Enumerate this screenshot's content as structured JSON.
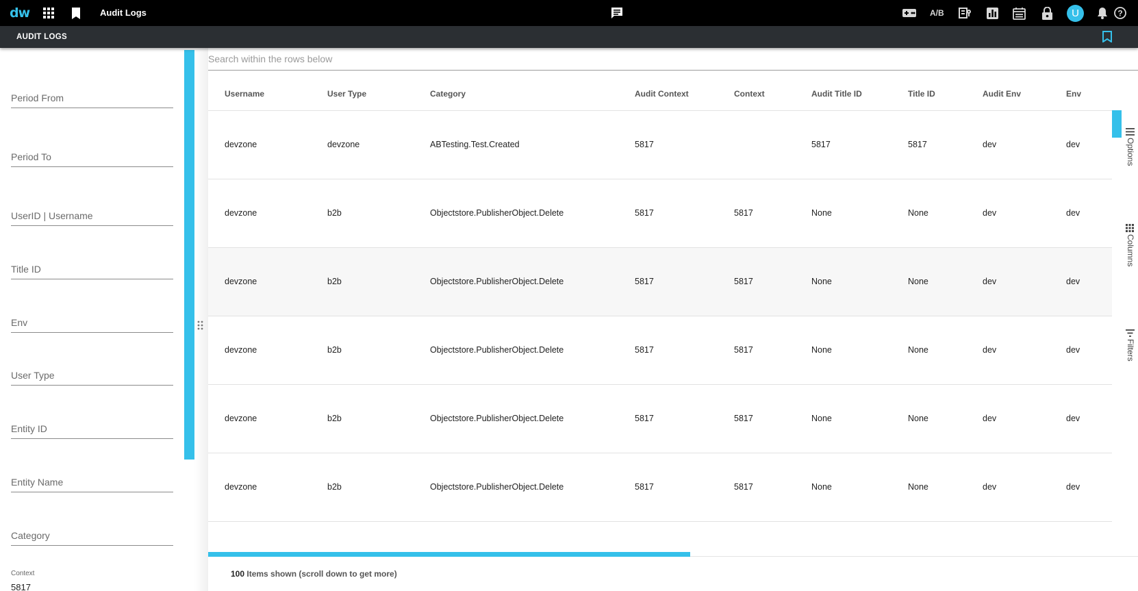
{
  "app": {
    "logo": "dw",
    "title": "Audit Logs",
    "ab_label": "A/B",
    "avatar_initial": "U"
  },
  "subheader": {
    "title": "AUDIT LOGS"
  },
  "filters": {
    "fields": [
      "Period From",
      "Period To",
      "UserID | Username",
      "Title ID",
      "Env",
      "User Type",
      "Entity ID",
      "Entity Name",
      "Category"
    ],
    "context_label": "Context",
    "context_value": "5817"
  },
  "search": {
    "placeholder": "Search within the rows below"
  },
  "table": {
    "columns": [
      "Username",
      "User Type",
      "Category",
      "Audit Context",
      "Context",
      "Audit Title ID",
      "Title ID",
      "Audit Env",
      "Env"
    ],
    "rows": [
      [
        "devzone",
        "devzone",
        "ABTesting.Test.Created",
        "5817",
        "",
        "5817",
        "5817",
        "dev",
        "dev"
      ],
      [
        "devzone",
        "b2b",
        "Objectstore.PublisherObject.Delete",
        "5817",
        "5817",
        "None",
        "None",
        "dev",
        "dev"
      ],
      [
        "devzone",
        "b2b",
        "Objectstore.PublisherObject.Delete",
        "5817",
        "5817",
        "None",
        "None",
        "dev",
        "dev"
      ],
      [
        "devzone",
        "b2b",
        "Objectstore.PublisherObject.Delete",
        "5817",
        "5817",
        "None",
        "None",
        "dev",
        "dev"
      ],
      [
        "devzone",
        "b2b",
        "Objectstore.PublisherObject.Delete",
        "5817",
        "5817",
        "None",
        "None",
        "dev",
        "dev"
      ],
      [
        "devzone",
        "b2b",
        "Objectstore.PublisherObject.Delete",
        "5817",
        "5817",
        "None",
        "None",
        "dev",
        "dev"
      ]
    ]
  },
  "side_tools": {
    "options": "Options",
    "columns": "Columns",
    "filters": "Filters"
  },
  "status": {
    "count": "100",
    "text": " Items shown (scroll down to get more)"
  },
  "colors": {
    "accent": "#35c0ea",
    "topbar": "#000000",
    "subbar": "#2b2f33"
  },
  "icons": [
    "apps-grid-icon",
    "bookmark-icon",
    "chat-icon",
    "gamepad-icon",
    "report-icon",
    "bar-chart-icon",
    "calendar-icon",
    "lock-icon",
    "bell-icon",
    "help-icon",
    "bookmark-outline-icon",
    "drag-handle-icon",
    "options-icon",
    "columns-icon",
    "filters-icon"
  ]
}
